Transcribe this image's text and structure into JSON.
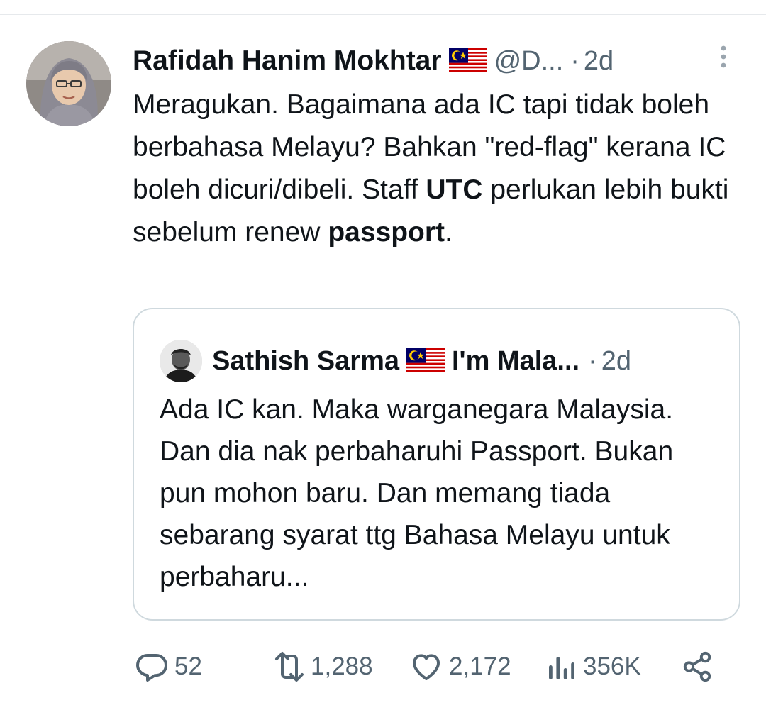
{
  "tweet": {
    "author_name": "Rafidah Hanim Mokhtar",
    "handle": "@D...",
    "separator": "·",
    "time": "2d",
    "body_parts": [
      {
        "text": "Meragukan. Bagaimana ada IC tapi tidak boleh berbahasa Melayu? Bahkan \"red-flag\" kerana IC boleh dicuri/dibeli. Staff ",
        "bold": false
      },
      {
        "text": "UTC",
        "bold": true
      },
      {
        "text": " perlukan lebih bukti sebelum renew ",
        "bold": false
      },
      {
        "text": "passport",
        "bold": true
      },
      {
        "text": ".",
        "bold": false
      }
    ]
  },
  "quote": {
    "author_name": "Sathish Sarma",
    "handle": "I'm Mala...",
    "separator": "·",
    "time": "2d",
    "text": "Ada IC kan. Maka warganegara Malaysia. Dan dia nak perbaharuhi Passport. Bukan pun mohon baru. Dan memang tiada sebarang syarat ttg Bahasa Melayu untuk perbaharu..."
  },
  "actions": {
    "replies": "52",
    "reposts": "1,288",
    "likes": "2,172",
    "views": "356K"
  },
  "icons": {
    "flag": "malaysia-flag-icon",
    "more": "more-vertical-icon",
    "reply": "reply-icon",
    "repost": "repost-icon",
    "like": "heart-icon",
    "views": "views-icon",
    "share": "share-icon"
  },
  "colors": {
    "text_primary": "#0f1419",
    "text_secondary": "#536471",
    "border": "#cfd9de"
  }
}
